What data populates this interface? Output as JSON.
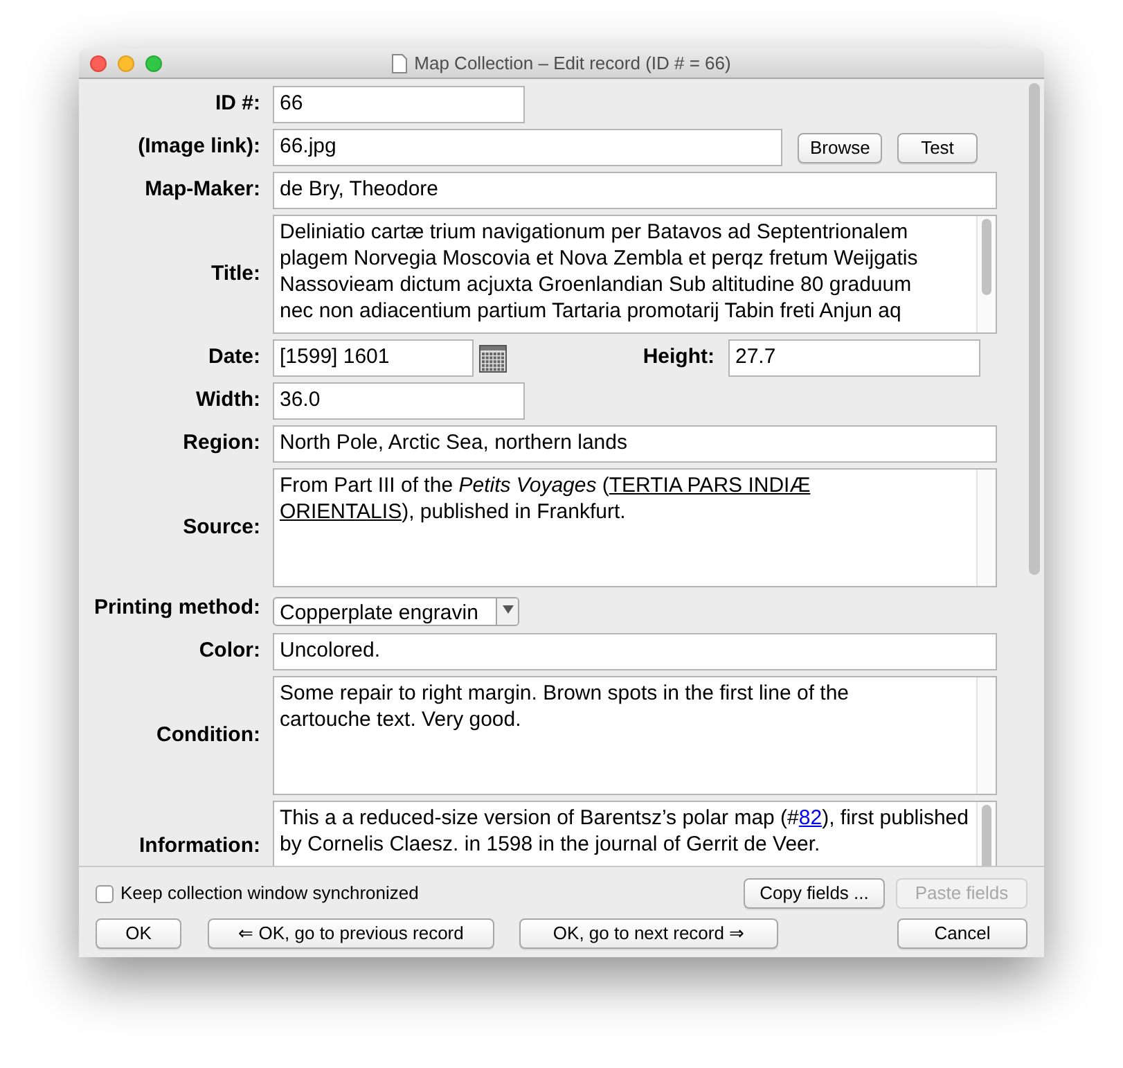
{
  "window": {
    "title": "Map Collection – Edit record (ID # = 66)"
  },
  "fields": [
    {
      "kind": "short",
      "label": "ID #:",
      "value": "66"
    },
    {
      "kind": "link",
      "label": "(Image link):",
      "value": "66.jpg",
      "buttons": [
        "Browse",
        "Test"
      ]
    },
    {
      "kind": "text",
      "label": "Map-Maker:",
      "value": "de Bry, Theodore"
    },
    {
      "kind": "area",
      "label": "Title:",
      "lines": [
        "Deliniatio cartæ trium navigationum per Batavos ad Septentrionalem",
        "plagem Norvegia Moscovia et Nova Zembla et perqz fretum Weijgatis",
        "Nassovieam dictum acjuxta Groenlandian Sub altitudine 80 graduum",
        "nec non adiacentium partium Tartaria promotarij Tabin freti Anjun aq"
      ]
    },
    {
      "kind": "date",
      "label": "Date:",
      "value": "[1599] 1601",
      "label2": "Height:",
      "value2": "27.7"
    },
    {
      "kind": "short",
      "label": "Width:",
      "value": "36.0"
    },
    {
      "kind": "text",
      "label": "Region:",
      "value": "North Pole, Arctic Sea, northern lands"
    },
    {
      "kind": "rich",
      "label": "Source:",
      "segments": [
        {
          "kind": "text",
          "text": "From Part III of the "
        },
        {
          "kind": "italic",
          "text": "Petits Voyages"
        },
        {
          "kind": "text",
          "text": " ("
        },
        {
          "kind": "underline",
          "text": "TERTIA PARS INDIÆ ORIENTALIS"
        },
        {
          "kind": "text",
          "text": "), published in Frankfurt."
        }
      ]
    },
    {
      "kind": "select",
      "label": "Printing method:",
      "value": "Copperplate engravin"
    },
    {
      "kind": "text",
      "label": "Color:",
      "value": "Uncolored."
    },
    {
      "kind": "rich",
      "label": "Condition:",
      "segments": [
        {
          "kind": "text",
          "text": "Some repair to right margin. Brown spots in the first line of the cartouche text. Very good."
        }
      ]
    },
    {
      "kind": "info",
      "label": "Information:",
      "segments": [
        {
          "kind": "text",
          "text": "This a a reduced-size version of Barentsz’s polar map (#"
        },
        {
          "kind": "link",
          "text": "82"
        },
        {
          "kind": "text",
          "text": "), first published by Cornelis Claesz. in 1598 in the journal of Gerrit de Veer."
        }
      ]
    }
  ],
  "sync": {
    "label": "Keep collection window synchronized",
    "checked": false
  },
  "copy_button": {
    "label": "Copy fields ...",
    "disabled": false
  },
  "paste_button": {
    "label": "Paste fields",
    "disabled": true
  },
  "buttons": [
    {
      "label": "OK",
      "kind": "ok"
    },
    {
      "label": "⇐ OK, go to previous record",
      "kind": "prev"
    },
    {
      "label": "OK, go to next record ⇒",
      "kind": "next"
    },
    {
      "label": "Cancel",
      "kind": "cancel"
    }
  ]
}
